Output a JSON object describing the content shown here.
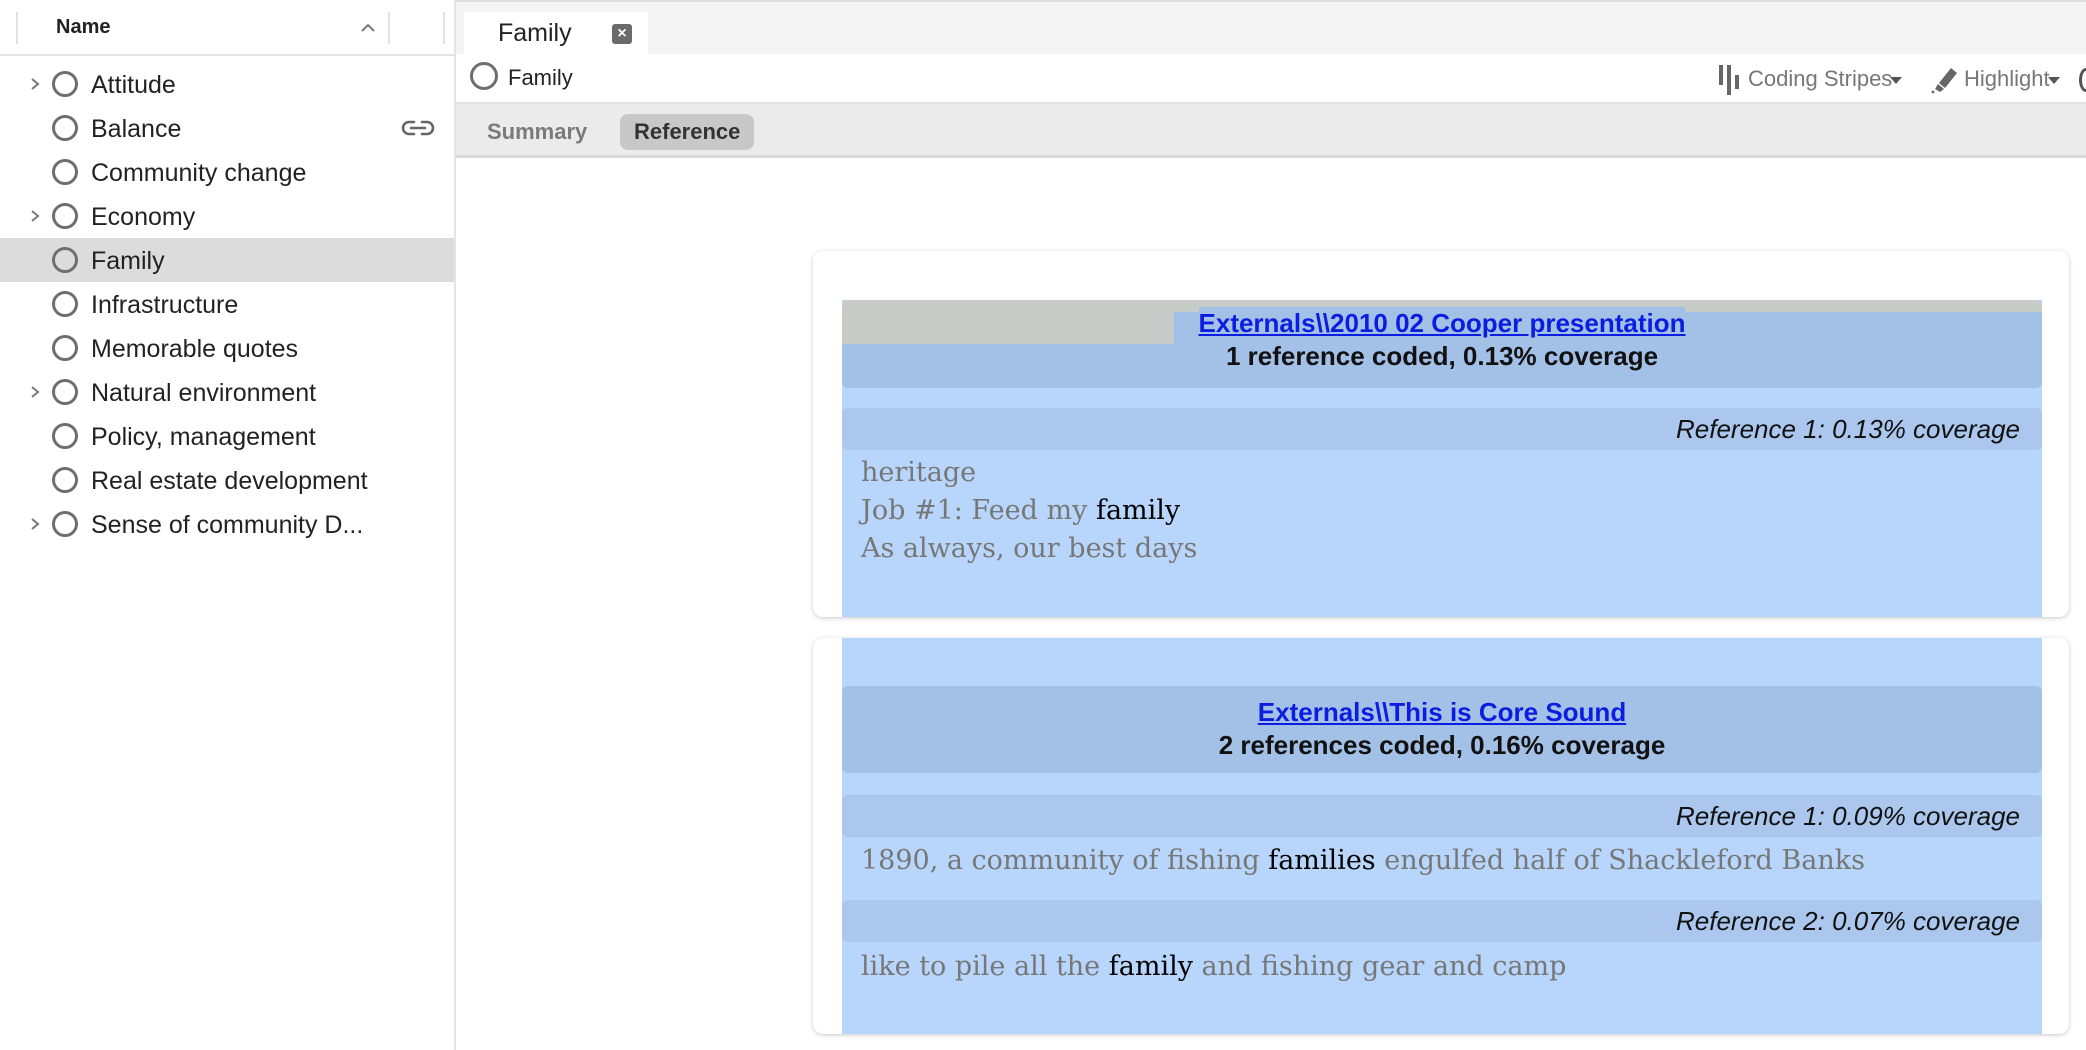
{
  "sidebar": {
    "header": {
      "name_label": "Name"
    },
    "items": [
      {
        "label": "Attitude",
        "expandable": true,
        "selected": false,
        "linked": false
      },
      {
        "label": "Balance",
        "expandable": false,
        "selected": false,
        "linked": true
      },
      {
        "label": "Community change",
        "expandable": false,
        "selected": false,
        "linked": false
      },
      {
        "label": "Economy",
        "expandable": true,
        "selected": false,
        "linked": false
      },
      {
        "label": "Family",
        "expandable": false,
        "selected": true,
        "linked": false
      },
      {
        "label": "Infrastructure",
        "expandable": false,
        "selected": false,
        "linked": false
      },
      {
        "label": "Memorable quotes",
        "expandable": false,
        "selected": false,
        "linked": false
      },
      {
        "label": "Natural environment",
        "expandable": true,
        "selected": false,
        "linked": false
      },
      {
        "label": "Policy, management",
        "expandable": false,
        "selected": false,
        "linked": false
      },
      {
        "label": "Real estate development",
        "expandable": false,
        "selected": false,
        "linked": false
      },
      {
        "label": "Sense of community D...",
        "expandable": true,
        "selected": false,
        "linked": false
      }
    ]
  },
  "tabs": [
    {
      "label": "Family",
      "close_icon": "close-icon"
    }
  ],
  "node_bar": {
    "node_label": "Family",
    "coding_stripes_label": "Coding Stripes",
    "highlight_label": "Highlight"
  },
  "view_tabs": {
    "summary": "Summary",
    "reference": "Reference",
    "active": "Reference"
  },
  "colors": {
    "link": "#0b1de0",
    "card_blue": "#b8d5fb",
    "header_band": "#a3c1e7",
    "ref_band": "#abc7ed",
    "selected_row": "#dcdcdc"
  },
  "cards": [
    {
      "source_link": "Externals\\\\2010 02 Cooper presentation",
      "summary": "1 reference coded, 0.13% coverage",
      "references": [
        {
          "label": "Reference 1: 0.13% coverage",
          "lines": [
            [
              {
                "t": "heritage",
                "hl": false
              }
            ],
            [
              {
                "t": "Job #1: Feed my ",
                "hl": false
              },
              {
                "t": "family",
                "hl": true
              }
            ],
            [
              {
                "t": "As always, our best days",
                "hl": false
              }
            ]
          ]
        }
      ]
    },
    {
      "source_link": "Externals\\\\This is Core Sound",
      "summary": "2 references coded, 0.16% coverage",
      "references": [
        {
          "label": "Reference 1: 0.09% coverage",
          "lines": [
            [
              {
                "t": "1890, a community of fishing ",
                "hl": false
              },
              {
                "t": "families",
                "hl": true
              },
              {
                "t": " engulfed half of Shackleford Banks",
                "hl": false
              }
            ]
          ]
        },
        {
          "label": "Reference 2: 0.07% coverage",
          "lines": [
            [
              {
                "t": "like to pile all the ",
                "hl": false
              },
              {
                "t": "family",
                "hl": true
              },
              {
                "t": " and fishing gear and camp",
                "hl": false
              }
            ]
          ]
        }
      ]
    }
  ]
}
